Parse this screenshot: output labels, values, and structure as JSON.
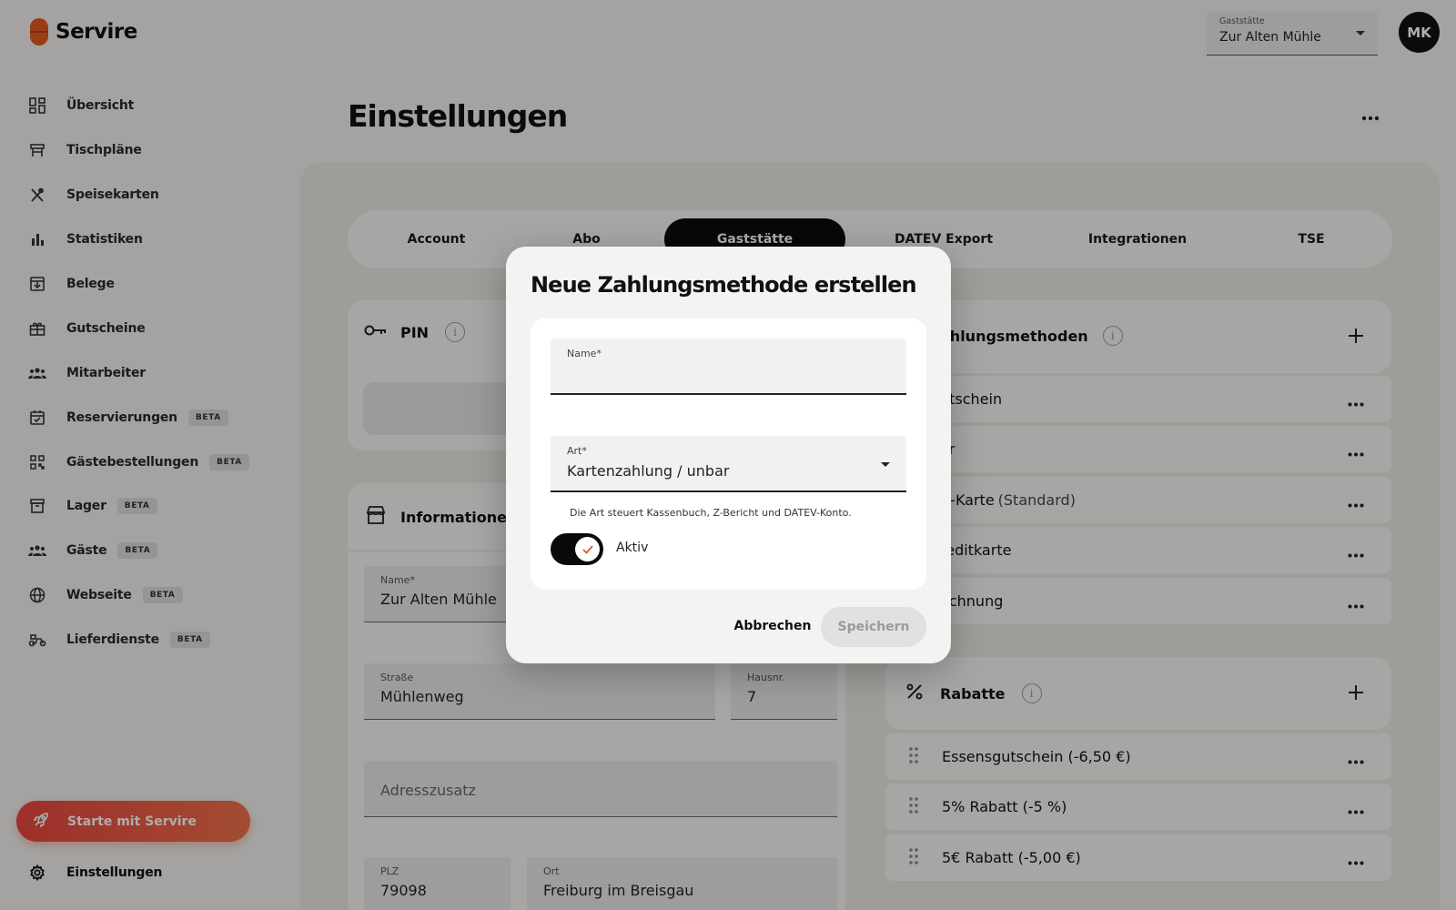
{
  "app": {
    "name": "Servire"
  },
  "venue": {
    "label": "Gaststätte",
    "value": "Zur Alten Mühle"
  },
  "user": {
    "initials": "MK"
  },
  "page": {
    "title": "Einstellungen"
  },
  "sidebar": {
    "items": [
      {
        "label": "Übersicht",
        "icon": "dashboard-icon",
        "badge": ""
      },
      {
        "label": "Tischpläne",
        "icon": "table-icon",
        "badge": ""
      },
      {
        "label": "Speisekarten",
        "icon": "cutlery-icon",
        "badge": ""
      },
      {
        "label": "Statistiken",
        "icon": "bar-chart-icon",
        "badge": ""
      },
      {
        "label": "Belege",
        "icon": "receipt-icon",
        "badge": ""
      },
      {
        "label": "Gutscheine",
        "icon": "gift-icon",
        "badge": ""
      },
      {
        "label": "Mitarbeiter",
        "icon": "team-icon",
        "badge": ""
      },
      {
        "label": "Reservierungen",
        "icon": "calendar-icon",
        "badge": "BETA"
      },
      {
        "label": "Gästebestellungen",
        "icon": "qr-icon",
        "badge": "BETA"
      },
      {
        "label": "Lager",
        "icon": "archive-icon",
        "badge": "BETA"
      },
      {
        "label": "Gäste",
        "icon": "guests-icon",
        "badge": "BETA"
      },
      {
        "label": "Webseite",
        "icon": "globe-icon",
        "badge": "BETA"
      },
      {
        "label": "Lieferdienste",
        "icon": "scooter-icon",
        "badge": "BETA"
      }
    ],
    "start_label": "Starte mit Servire",
    "settings_label": "Einstellungen"
  },
  "tabs": [
    "Account",
    "Abo",
    "Gaststätte",
    "DATEV Export",
    "Integrationen",
    "TSE"
  ],
  "active_tab": "Gaststätte",
  "pin_card": {
    "title": "PIN"
  },
  "info_card": {
    "title": "Informationen",
    "name_label": "Name*",
    "name_value": "Zur Alten Mühle",
    "street_label": "Straße",
    "street_value": "Mühlenweg",
    "number_label": "Hausnr.",
    "number_value": "7",
    "addition_placeholder": "Adresszusatz",
    "zip_label": "PLZ",
    "zip_value": "79098",
    "city_label": "Ort",
    "city_value": "Freiburg im Breisgau"
  },
  "payment_card": {
    "title": "ahlungsmethoden",
    "items": [
      {
        "name": "utschein",
        "suffix": ""
      },
      {
        "name": "ar",
        "suffix": ""
      },
      {
        "name": "C-Karte",
        "suffix": "(Standard)"
      },
      {
        "name": "reditkarte",
        "suffix": ""
      },
      {
        "name": "echnung",
        "suffix": ""
      }
    ]
  },
  "discount_card": {
    "title": "Rabatte",
    "items": [
      "Essensgutschein (-6,50 €)",
      "5% Rabatt (-5 %)",
      "5€ Rabatt (-5,00 €)"
    ]
  },
  "modal": {
    "title": "Neue Zahlungsmethode erstellen",
    "name_label": "Name*",
    "name_value": "",
    "type_label": "Art*",
    "type_value": "Kartenzahlung / unbar",
    "hint": "Die Art steuert Kassenbuch, Z-Bericht und DATEV-Konto.",
    "active_label": "Aktiv",
    "active": true,
    "cancel_label": "Abbrechen",
    "save_label": "Speichern"
  },
  "colors": {
    "accent": "#e05a1f",
    "start_gradient_from": "#e8463e",
    "start_gradient_to": "#f0704a",
    "toggle_on": "#0a0a0a"
  }
}
